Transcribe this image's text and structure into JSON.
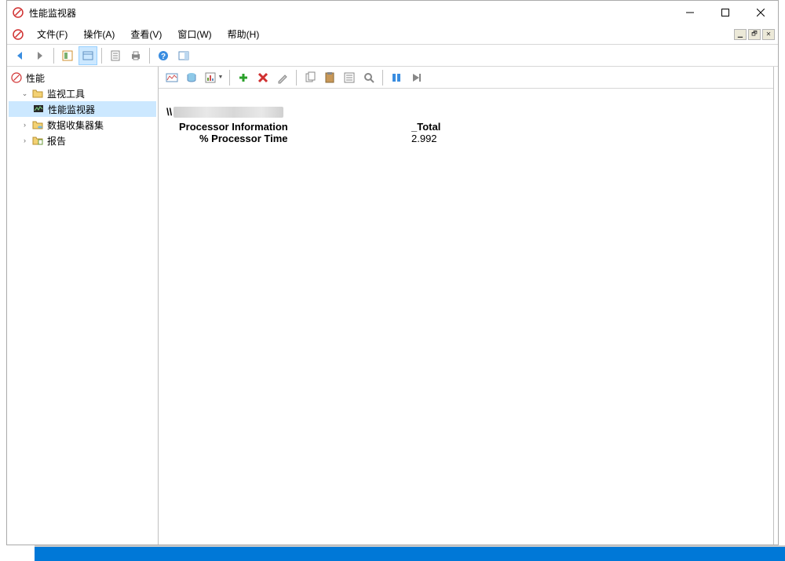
{
  "window": {
    "title": "性能监视器"
  },
  "menubar": {
    "file": "文件(F)",
    "action": "操作(A)",
    "view": "查看(V)",
    "window": "窗口(W)",
    "help": "帮助(H)"
  },
  "tree": {
    "root": "性能",
    "monitoring_tools": "监视工具",
    "perf_monitor": "性能监视器",
    "collector_sets": "数据收集器集",
    "reports": "报告"
  },
  "report": {
    "host_prefix": "\\\\",
    "group": "Processor Information",
    "instance": "_Total",
    "counter": "% Processor Time",
    "value": "2.992"
  }
}
